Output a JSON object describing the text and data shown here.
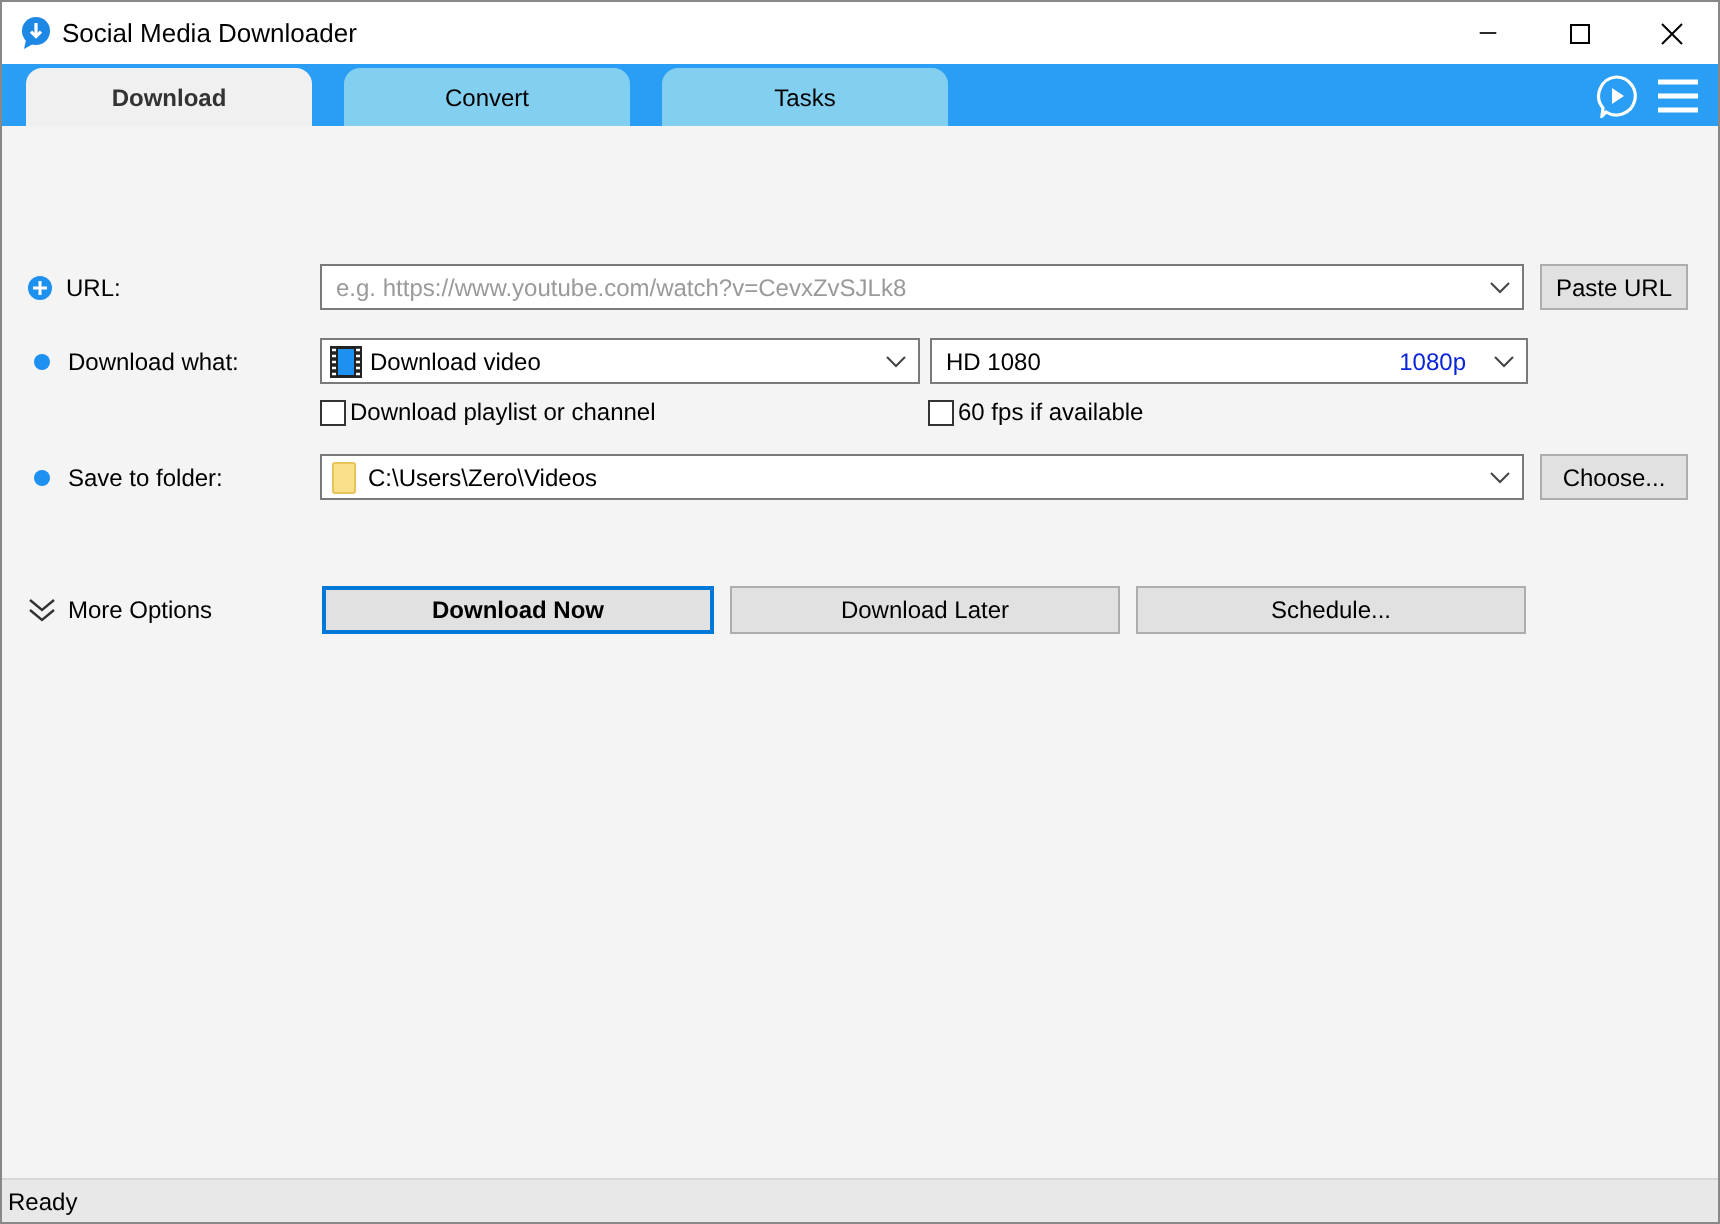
{
  "window": {
    "title": "Social Media Downloader"
  },
  "tabs": [
    {
      "label": "Download",
      "selected": true
    },
    {
      "label": "Convert",
      "selected": false
    },
    {
      "label": "Tasks",
      "selected": false
    }
  ],
  "form": {
    "url": {
      "label": "URL:",
      "placeholder": "e.g. https://www.youtube.com/watch?v=CevxZvSJLk8",
      "button": "Paste URL"
    },
    "download_what": {
      "label": "Download what:",
      "value": "Download video",
      "quality": "HD 1080",
      "quality_tag": "1080p"
    },
    "checkboxes": [
      {
        "label": "Download playlist or channel",
        "checked": false
      },
      {
        "label": "60 fps if available",
        "checked": false
      }
    ],
    "save_folder": {
      "label": "Save to folder:",
      "value": "C:\\Users\\Zero\\Videos",
      "button": "Choose..."
    }
  },
  "more_options": {
    "label": "More Options"
  },
  "buttons": [
    {
      "label": "Download Now",
      "focused": true
    },
    {
      "label": "Download Later",
      "focused": false
    },
    {
      "label": "Schedule...",
      "focused": false
    }
  ],
  "status_bar": {
    "text": "Ready"
  }
}
